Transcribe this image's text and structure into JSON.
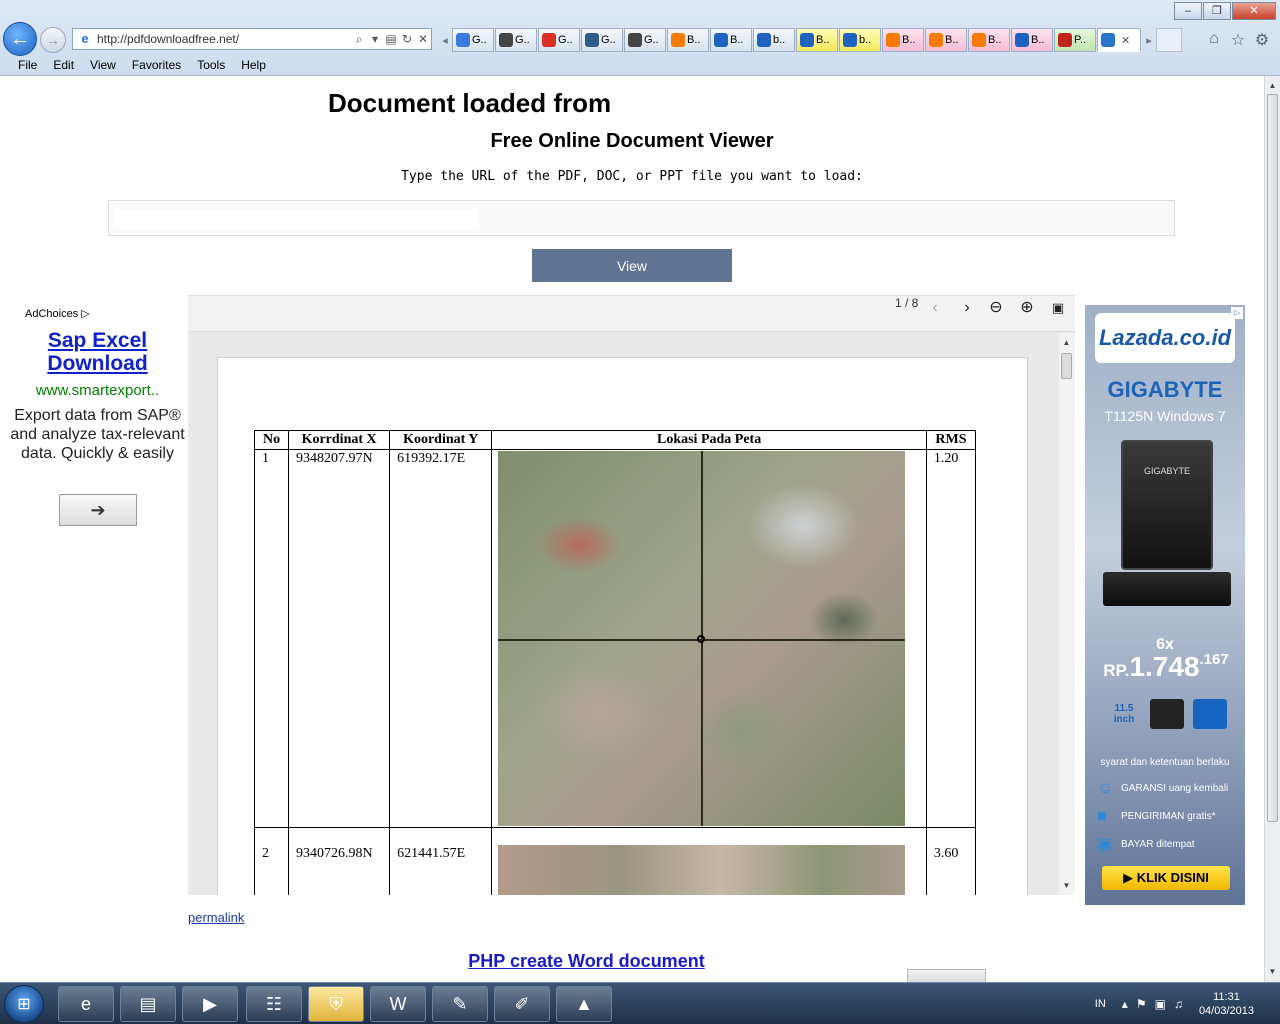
{
  "browser": {
    "address": "http://pdfdownloadfree.net/",
    "tabs": [
      {
        "label": "G..",
        "color": "#3b7be0",
        "style": ""
      },
      {
        "label": "G..",
        "color": "#444444",
        "style": ""
      },
      {
        "label": "G..",
        "color": "#d93025",
        "style": ""
      },
      {
        "label": "G..",
        "color": "#2f5d8a",
        "style": ""
      },
      {
        "label": "G..",
        "color": "#444444",
        "style": ""
      },
      {
        "label": "B..",
        "color": "#f57c00",
        "style": ""
      },
      {
        "label": "B..",
        "color": "#1f63c1",
        "style": ""
      },
      {
        "label": "b..",
        "color": "#1f63c1",
        "style": ""
      },
      {
        "label": "B..",
        "color": "#1f63c1",
        "style": "yellow"
      },
      {
        "label": "b..",
        "color": "#1f63c1",
        "style": "yellow"
      },
      {
        "label": "B..",
        "color": "#f57c00",
        "style": "pink"
      },
      {
        "label": "B..",
        "color": "#f57c00",
        "style": "pink"
      },
      {
        "label": "B..",
        "color": "#f57c00",
        "style": "pink"
      },
      {
        "label": "B..",
        "color": "#1f63c1",
        "style": "pink"
      },
      {
        "label": "P..",
        "color": "#c0231b",
        "style": "green"
      }
    ],
    "menu": [
      "File",
      "Edit",
      "View",
      "Favorites",
      "Tools",
      "Help"
    ]
  },
  "page": {
    "doc_title": "Document loaded from",
    "viewer_title": "Free Online Document Viewer",
    "instruction": "Type the URL of the PDF, DOC, or PPT file you want to load:",
    "url_value": "",
    "view_label": "View",
    "permalink": "permalink",
    "bottom_link": "PHP create Word document"
  },
  "left_ad": {
    "adchoices": "AdChoices",
    "headline": "Sap Excel Download",
    "domain": "www.smartexport..",
    "body": "Export data from SAP® and analyze tax-relevant data. Quickly & easily"
  },
  "viewer": {
    "page_counter": "1 / 8",
    "table": {
      "headers": [
        "No",
        "Korrdinat X",
        "Koordinat Y",
        "Lokasi Pada Peta",
        "RMS"
      ],
      "rows": [
        {
          "no": "1",
          "x": "9348207.97N",
          "y": "619392.17E",
          "rms": "1.20"
        },
        {
          "no": "2",
          "x": "9340726.98N",
          "y": "621441.57E",
          "rms": "3.60"
        }
      ]
    }
  },
  "right_ad": {
    "logo": "Lazada.co.id",
    "brand": "GIGABYTE",
    "model": "T1125N Windows 7",
    "laptop_label": "GIGABYTE",
    "times": "6x",
    "price_prefix": "RP.",
    "price_main": "1.748",
    "price_sup": ".167",
    "badge_size": "11.5 inch",
    "terms": "syarat dan ketentuan berlaku",
    "feature_1": "GARANSI uang kembali",
    "feature_2": "PENGIRIMAN gratis*",
    "feature_3": "BAYAR ditempat",
    "cta": "KLIK DISINI"
  },
  "taskbar": {
    "lang": "IN",
    "time": "11:31",
    "date": "04/03/2013"
  }
}
